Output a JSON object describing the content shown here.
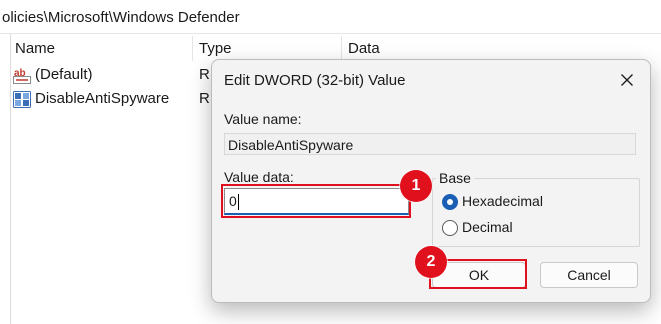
{
  "address_bar": {
    "path": "olicies\\Microsoft\\Windows Defender"
  },
  "list": {
    "columns": [
      "Name",
      "Type",
      "Data"
    ],
    "rows": [
      {
        "name": "(Default)",
        "type": "RE",
        "icon": "string-value-icon"
      },
      {
        "name": "DisableAntiSpyware",
        "type": "RE",
        "icon": "dword-value-icon"
      }
    ]
  },
  "dialog": {
    "title": "Edit DWORD (32-bit) Value",
    "value_name_label": "Value name:",
    "value_name": "DisableAntiSpyware",
    "value_data_label": "Value data:",
    "value_data": "0",
    "base_label": "Base",
    "base_options": [
      "Hexadecimal",
      "Decimal"
    ],
    "base_selected": "Hexadecimal",
    "ok_label": "OK",
    "cancel_label": "Cancel"
  },
  "annotations": {
    "badge_1": "1",
    "badge_2": "2",
    "color": "#e0101c"
  },
  "colors": {
    "accent": "#1a5fb4",
    "dialog_bg": "#f3f3f3"
  }
}
